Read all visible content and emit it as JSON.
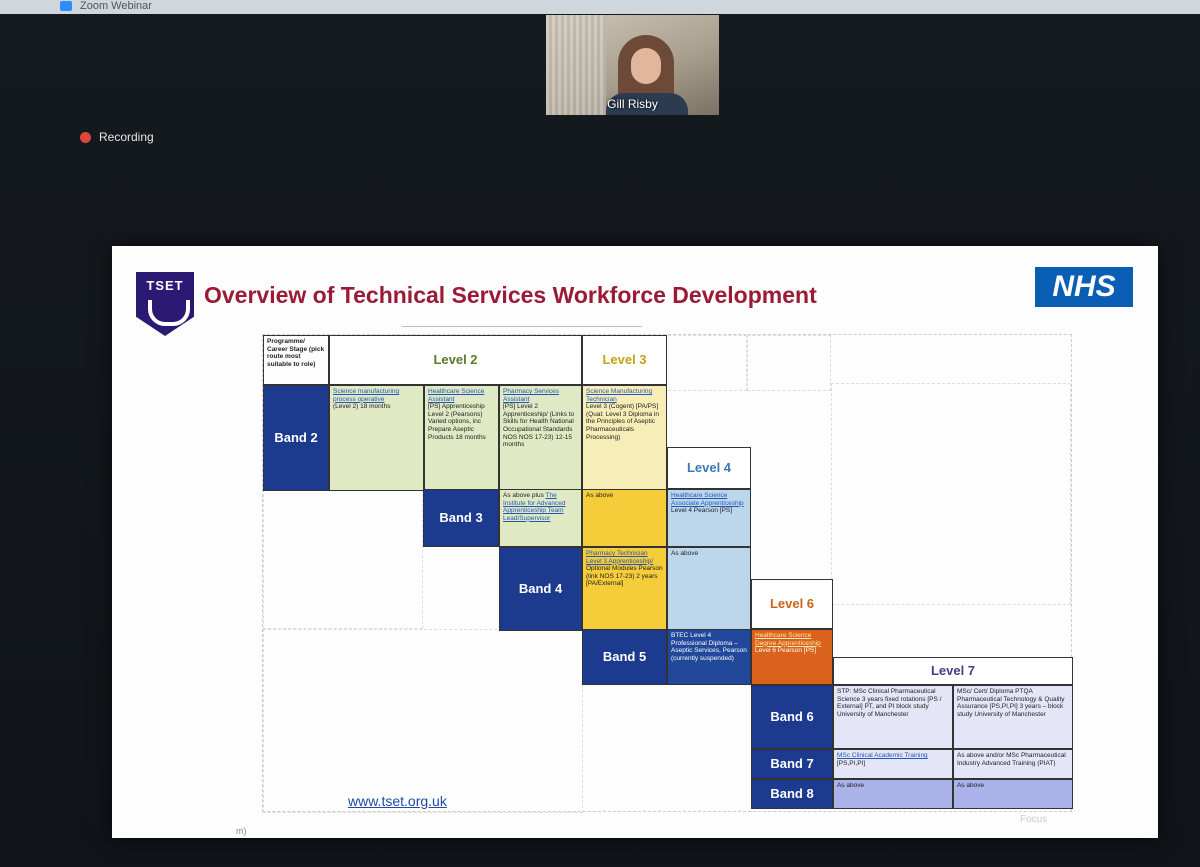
{
  "window": {
    "title": "Zoom Webinar"
  },
  "speaker": {
    "name": "Gill Risby"
  },
  "recording": {
    "label": "Recording"
  },
  "slide": {
    "logo_text": "TSET",
    "title": "Overview of Technical Services Workforce Development",
    "nhs_logo": "NHS",
    "url": "www.tset.org.uk",
    "header": "Programme/ Career Stage (pick route most suitable to role)",
    "levels": {
      "l2": "Level 2",
      "l3": "Level 3",
      "l4": "Level 4",
      "l6": "Level 6",
      "l7": "Level 7"
    },
    "bands": {
      "b2": "Band 2",
      "b3": "Band 3",
      "b4": "Band 4",
      "b5": "Band 5",
      "b6": "Band 6",
      "b7": "Band 7",
      "b8": "Band 8"
    },
    "cells": {
      "b2_c1_link": "Science manufacturing process operative",
      "b2_c1_text": "(Level 2) 18 months",
      "b2_c2_link": "Healthcare Science Assistant",
      "b2_c2_text": "[PS] Apprenticeship Level 2 (Pearsons) Varied options, inc Prepare Aseptic Products 18 months",
      "b2_c3_link": "Pharmacy Services Assistant",
      "b2_c3_text": "[PS] Level 2 Apprenticeship/ (Links to Skills for Health National Occupational Standards NOS NOS 17-23) 12-15 months",
      "b2_c4_link": "Science Manufacturing Technician",
      "b2_c4_text": "Level 3 (Cogent) [PA/PS] (Qual: Level 3 Diploma in the Principles of Aseptic Pharmaceuticals Processing)",
      "b3_c1_text": "As above plus",
      "b3_c1_link": "The Institute for Advanced Apprenticeship Team Lead/Supervisor",
      "b3_c2_text": "As above",
      "b3_c3_link": "Healthcare Science Associate Apprenticeship",
      "b3_c3_text": "Level 4 Pearson [PS]",
      "b4_c1_link": "Pharmacy Technician Level 3 Apprenticeship/",
      "b4_c1_text": "Optional Modules Pearson (link NOS 17-23) 2 years [PA/External]",
      "b4_c2_text": "As above",
      "b5_c1_text": "BTEC Level 4 Professional Diploma – Aseptic Services, Pearson (currently suspended)",
      "b5_c2_link": "Healthcare Science Degree Apprenticeship",
      "b5_c2_text": "Level 6 Pearson [PS]",
      "b6_c1_text": "STP: MSc Clinical Pharmaceutical Science 3 years fixed rotations [PS / External] PT, and PI block study University of Manchester",
      "b6_c2_text": "MSc/ Cert/ Diploma PTQA Pharmaceutical Technology & Quality Assurance [PS,PI,PI] 3 years – block study University of Manchester",
      "b7_c1_link": "MSc Clinical Academic Training",
      "b7_c1_text": "[PS,PI,PI]",
      "b7_c2_text": "As above and/or MSc Pharmaceutical Industry Advanced Training (PIAT)",
      "b8_c1_text": "As above",
      "b8_c2_text": "As above"
    }
  },
  "footer": {
    "focus_label": "Focus",
    "m_label": "m)"
  },
  "colors": {
    "band": "#1c3b8f",
    "title": "#9b1b36",
    "nhs": "#0a5eb3",
    "orange": "#d9631c",
    "gold": "#f5cd3a"
  }
}
